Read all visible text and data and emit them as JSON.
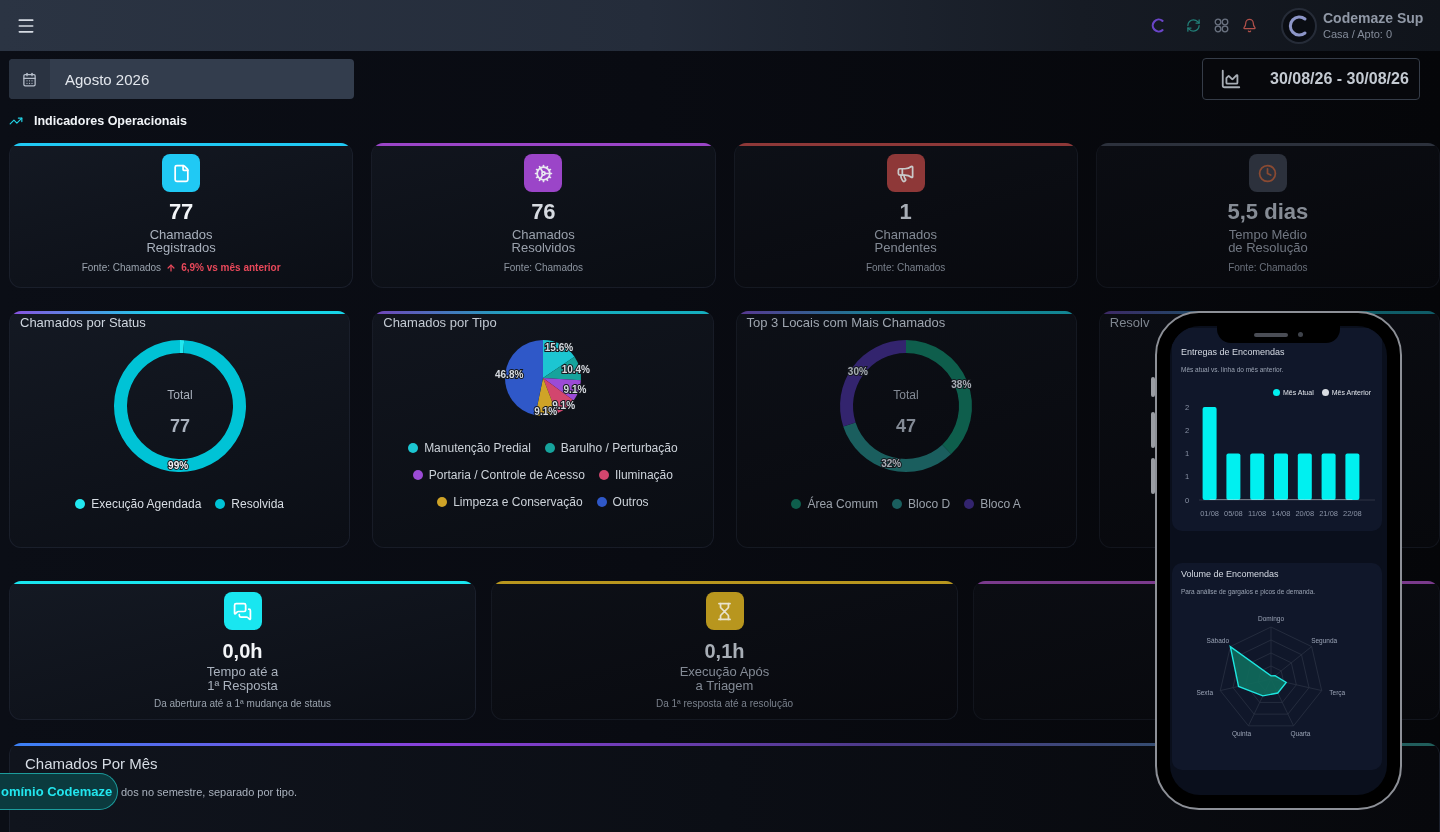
{
  "topbar": {
    "user_name": "Codemaze Sup",
    "user_unit": "Casa / Apto: 0"
  },
  "month_picker": {
    "value": "Agosto 2026"
  },
  "date_range": {
    "value": "30/08/26 - 30/08/26"
  },
  "section_title": "Indicadores Operacionais",
  "kpis": [
    {
      "color": "#20c9f4",
      "value": "77",
      "label": "Chamados\nRegistrados",
      "source": "Fonte: Chamados",
      "trend": "6,9% vs mês anterior"
    },
    {
      "color": "#9b45c8",
      "value": "76",
      "label": "Chamados\nResolvidos",
      "source": "Fonte: Chamados"
    },
    {
      "color": "#8e3838",
      "value": "1",
      "label": "Chamados\nPendentes",
      "source": "Fonte: Chamados"
    },
    {
      "color": "#2c313c",
      "value": "5,5 dias",
      "label": "Tempo Médio\nde Resolução",
      "source": "Fonte: Chamados"
    }
  ],
  "charts": [
    {
      "title": "Chamados por Status",
      "center_label": "Total",
      "center_value": "77",
      "chart_data": {
        "type": "donut",
        "categories": [
          "Execução Agendada",
          "Resolvida"
        ],
        "values": [
          1,
          99
        ],
        "colors": [
          "#22e8f0",
          "#00c3d6"
        ],
        "value_labels": [
          null,
          "99%"
        ]
      }
    },
    {
      "title": "Chamados por Tipo",
      "chart_data": {
        "type": "pie",
        "categories": [
          "Manutenção Predial",
          "Barulho / Perturbação",
          "Portaria / Controle de Acesso",
          "Iluminação",
          "Limpeza e Conservação",
          "Outros"
        ],
        "values": [
          15.6,
          10.4,
          9.1,
          9.1,
          9.1,
          46.8
        ],
        "colors": [
          "#1cc6d2",
          "#16a39c",
          "#9b4bd6",
          "#d2466e",
          "#cfa327",
          "#2f58c8"
        ],
        "value_labels": [
          "15.6%",
          "10.4%",
          "9.1%",
          "9.1%",
          "9.1%",
          "46.8%"
        ]
      }
    },
    {
      "title": "Top 3 Locais com Mais Chamados",
      "center_label": "Total",
      "center_value": "47",
      "chart_data": {
        "type": "donut",
        "categories": [
          "Área Comum",
          "Bloco D",
          "Bloco A"
        ],
        "values": [
          38,
          32,
          30
        ],
        "colors": [
          "#0e5e4c",
          "#1a5e5e",
          "#33246e"
        ],
        "value_labels": [
          "38%",
          "32%",
          "30%"
        ]
      }
    },
    {
      "title": "Resolv"
    }
  ],
  "time_kpis": [
    {
      "color": "#19e6f0",
      "value": "0,0h",
      "label": "Tempo até a\n1ª Resposta",
      "note": "Da abertura até a 1ª mudança de status"
    },
    {
      "color": "#b8961e",
      "value": "0,1h",
      "label": "Execução Após\na Triagem",
      "note": "Da 1ª resposta até a resolução"
    },
    {
      "color": "#7a3a8c"
    }
  ],
  "monthly": {
    "title": "Chamados Por Mês",
    "subtitle": "dos no semestre, separado por tipo."
  },
  "domain_button": {
    "label": "omínio Codemaze"
  },
  "phone": {
    "deliveries": {
      "title": "Entregas de Encomendas",
      "subtitle": "Mês atual vs. linha do mês anterior.",
      "chart_data": {
        "type": "bar",
        "categories": [
          "01/08",
          "05/08",
          "11/08",
          "14/08",
          "20/08",
          "21/08",
          "22/08"
        ],
        "series": [
          {
            "name": "Mês Atual",
            "color": "#00f0f0",
            "values": [
              2,
              1,
              1,
              1,
              1,
              1,
              1
            ]
          },
          {
            "name": "Mês Anterior",
            "color": "#d9dde3",
            "values": [
              0,
              0,
              0,
              0,
              0,
              0,
              0
            ]
          }
        ],
        "ylim": [
          0,
          2
        ],
        "yticks": [
          {
            "value": 0,
            "label": "0"
          },
          {
            "value": 0.5,
            "label": "1"
          },
          {
            "value": 1,
            "label": "1"
          },
          {
            "value": 1.5,
            "label": "2"
          },
          {
            "value": 2,
            "label": "2"
          }
        ]
      }
    },
    "volume": {
      "title": "Volume de Encomendas",
      "subtitle": "Para análise de gargalos e picos de demanda.",
      "axes": [
        "Domingo",
        "Segunda",
        "Terça",
        "Quarta",
        "Quinta",
        "Sexta",
        "Sábado"
      ]
    }
  }
}
